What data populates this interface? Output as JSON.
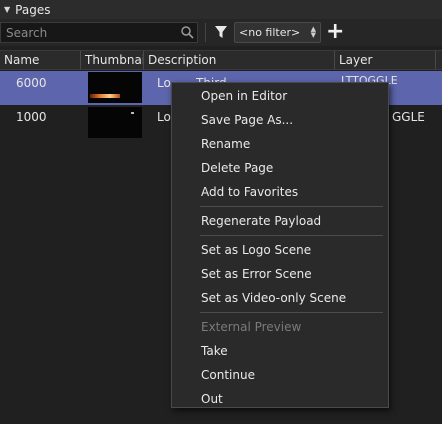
{
  "panel": {
    "title": "Pages"
  },
  "toolbar": {
    "search_placeholder": "Search",
    "filter_value": "<no filter>",
    "add_label": "+"
  },
  "columns": [
    "Name",
    "Thumbnail",
    "Description",
    "Layer"
  ],
  "rows": [
    {
      "name": "6000",
      "description": "Lo",
      "description_right": "Third",
      "layer": "LTTOGGLE",
      "selected": true
    },
    {
      "name": "1000",
      "description": "Lo",
      "layer": "GGLE",
      "selected": false
    }
  ],
  "context_menu": {
    "group1": [
      "Open in Editor",
      "Save Page As...",
      "Rename",
      "Delete Page",
      "Add to Favorites"
    ],
    "group2": [
      "Regenerate Payload"
    ],
    "group3": [
      "Set as Logo Scene",
      "Set as Error Scene",
      "Set as Video-only Scene"
    ],
    "group4": [
      "External Preview",
      "Take",
      "Continue",
      "Out"
    ]
  },
  "colors": {
    "background": "#202020",
    "selection": "#5d65ad",
    "menu_bg": "#2a2a2a",
    "disabled_text": "#7a7a7a"
  },
  "icons": {
    "collapse": "triangle-down-icon",
    "search": "search-icon",
    "filter": "funnel-icon",
    "select_arrows": "updown-arrows-icon"
  }
}
